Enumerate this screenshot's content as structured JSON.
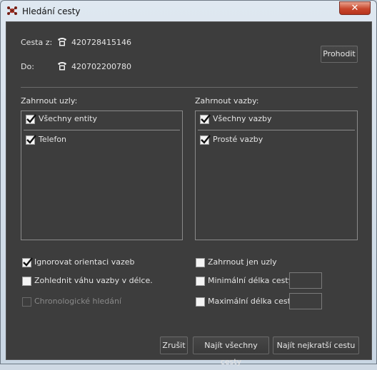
{
  "window": {
    "title": "Hledání cesty",
    "close_glyph": "✕"
  },
  "route": {
    "from_label": "Cesta z:",
    "from_value": "420728415146",
    "to_label": "Do:",
    "to_value": "420702200780",
    "node_icon": "telephone-icon"
  },
  "swap_button": "Prohodit",
  "nodes": {
    "heading": "Zahrnout uzly:",
    "items": [
      {
        "label": "Všechny entity",
        "checked": true
      },
      {
        "label": "Telefon",
        "checked": true
      }
    ]
  },
  "links": {
    "heading": "Zahrnout vazby:",
    "items": [
      {
        "label": "Všechny vazby",
        "checked": true
      },
      {
        "label": "Prosté vazby",
        "checked": true
      }
    ]
  },
  "options": {
    "ignore_orientation": {
      "label": "Ignorovat orientaci vazeb",
      "checked": true
    },
    "weight_in_length": {
      "label": "Zohlednit váhu vazby v délce.",
      "checked": false
    },
    "chronological": {
      "label": "Chronologické hledání",
      "checked": false,
      "disabled": true
    },
    "only_nodes": {
      "label": "Zahrnout jen uzly",
      "checked": false
    },
    "min_length": {
      "label": "Minimální délka cesty",
      "checked": false,
      "value": ""
    },
    "max_length": {
      "label": "Maximální délka cesty",
      "checked": false,
      "value": ""
    }
  },
  "footer": {
    "cancel": "Zrušit",
    "find_all": "Najít všechny cesty",
    "find_shortest": "Najít nejkratší cestu"
  }
}
